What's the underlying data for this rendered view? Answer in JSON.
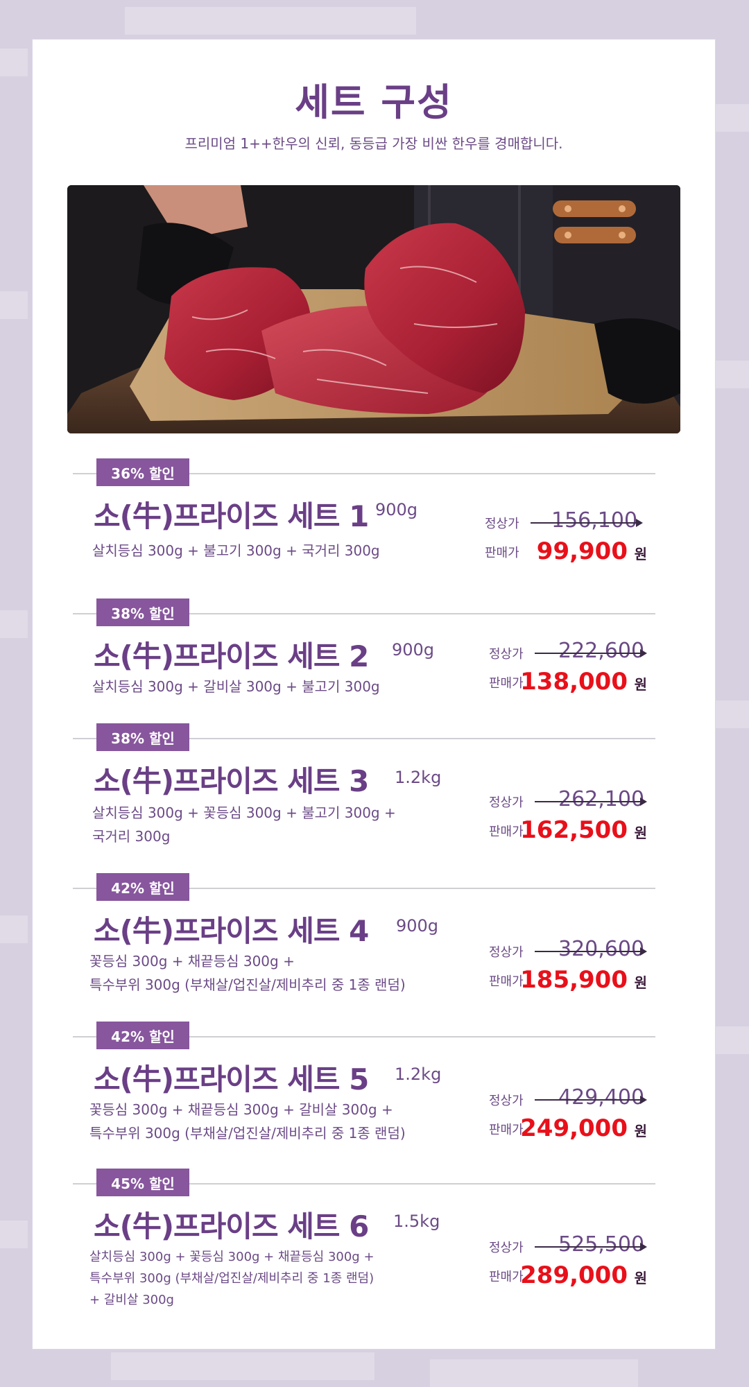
{
  "header": {
    "title": "세트 구성",
    "subtitle": "프리미엄 1++한우의 신뢰,  동등급 가장 비싼 한우를 경매합니다."
  },
  "labels": {
    "regular": "정상가",
    "sale": "판매가",
    "currency": "원"
  },
  "sets": [
    {
      "badge": "36% 할인",
      "name": "소(牛)프라이즈 세트 1",
      "weight": "900g",
      "desc": [
        "살치등심 300g + 불고기 300g + 국거리 300g"
      ],
      "regular_price": "156,100",
      "sale_price": "99,900"
    },
    {
      "badge": "38% 할인",
      "name": "소(牛)프라이즈 세트 2",
      "weight": "900g",
      "desc": [
        "살치등심 300g + 갈비살 300g + 불고기 300g"
      ],
      "regular_price": "222,600",
      "sale_price": "138,000"
    },
    {
      "badge": "38% 할인",
      "name": "소(牛)프라이즈 세트 3",
      "weight": "1.2kg",
      "desc": [
        "살치등심 300g + 꽃등심 300g + 불고기 300g +",
        "국거리 300g"
      ],
      "regular_price": "262,100",
      "sale_price": "162,500"
    },
    {
      "badge": "42% 할인",
      "name": "소(牛)프라이즈 세트 4",
      "weight": "900g",
      "desc": [
        "꽃등심 300g + 채끝등심 300g +",
        "특수부위 300g (부채살/업진살/제비추리 중 1종 랜덤)"
      ],
      "regular_price": "320,600",
      "sale_price": "185,900"
    },
    {
      "badge": "42% 할인",
      "name": "소(牛)프라이즈 세트 5",
      "weight": "1.2kg",
      "desc": [
        "꽃등심 300g + 채끝등심 300g + 갈비살 300g +",
        "특수부위 300g (부채살/업진살/제비추리 중 1종 랜덤)"
      ],
      "regular_price": "429,400",
      "sale_price": "249,000"
    },
    {
      "badge": "45% 할인",
      "name": "소(牛)프라이즈 세트 6",
      "weight": "1.5kg",
      "desc": [
        "살치등심 300g + 꽃등심 300g + 채끝등심 300g +",
        "특수부위 300g (부채살/업진살/제비추리 중 1종 랜덤)",
        "+ 갈비살 300g"
      ],
      "regular_price": "525,500",
      "sale_price": "289,000"
    }
  ],
  "colors": {
    "accent": "#6a3f86",
    "badge": "#87569d",
    "sale": "#e8101a"
  }
}
